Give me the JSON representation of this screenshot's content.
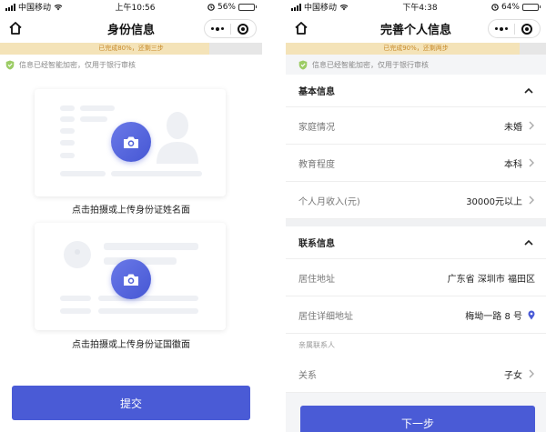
{
  "left": {
    "status": {
      "carrier": "中国移动",
      "time": "上午10:56",
      "battery": "56%",
      "battery_level": 0.56
    },
    "nav": {
      "title": "身份信息"
    },
    "progress": {
      "text": "已完成80%，还剩三步",
      "value": 0.8
    },
    "secure_notice": "信息已经智能加密，仅用于银行审核",
    "front_caption": "点击拍摄或上传身份证姓名面",
    "back_caption": "点击拍摄或上传身份证国徽面",
    "submit_label": "提交",
    "accent": "#4a5bd6"
  },
  "right": {
    "status": {
      "carrier": "中国移动",
      "time": "下午4:38",
      "battery": "64%",
      "battery_level": 0.64
    },
    "nav": {
      "title": "完善个人信息"
    },
    "progress": {
      "text": "已完成90%，还剩两步",
      "value": 0.9
    },
    "secure_notice": "信息已经智能加密，仅用于银行审核",
    "basic": {
      "title": "基本信息",
      "rows": [
        {
          "label": "家庭情况",
          "value": "未婚"
        },
        {
          "label": "教育程度",
          "value": "本科"
        },
        {
          "label": "个人月收入(元)",
          "value": "30000元以上"
        }
      ]
    },
    "contact": {
      "title": "联系信息",
      "residence_label": "居住地址",
      "residence_value": "广东省 深圳市 福田区",
      "detail_label": "居住详细地址",
      "detail_value": "梅坳一路 8 号",
      "relatives_label": "亲属联系人",
      "relation_label": "关系",
      "relation_value": "子女"
    },
    "next_label": "下一步"
  }
}
